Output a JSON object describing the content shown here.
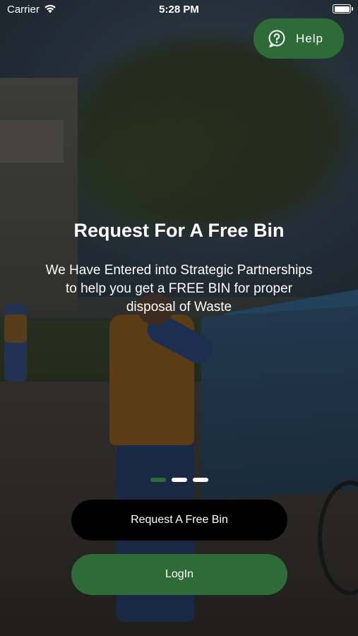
{
  "status_bar": {
    "carrier": "Carrier",
    "time": "5:28 PM"
  },
  "help": {
    "label": "Help",
    "icon": "question-circle-icon"
  },
  "slide": {
    "title": "Request For A Free Bin",
    "description": "We Have Entered into Strategic Partnerships to help you get a FREE BIN for proper disposal of Waste"
  },
  "pager": {
    "count": 3,
    "active_index": 0
  },
  "actions": {
    "request_label": "Request A Free Bin",
    "login_label": "LogIn"
  },
  "colors": {
    "brand_green": "#2f6b39",
    "request_button": "#000000",
    "text": "#ffffff"
  }
}
